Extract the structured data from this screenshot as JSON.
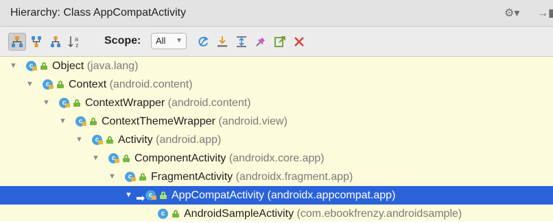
{
  "title": "Hierarchy: Class AppCompatActivity",
  "title_actions": {
    "gear": "⚙︎▾",
    "pin": "→▮"
  },
  "toolbar": {
    "scope_label": "Scope:",
    "scope_value": "All",
    "tools": [
      "class-hierarchy-icon",
      "supertypes-icon",
      "subtypes-icon",
      "sort-alphabetically-icon",
      "refresh-icon",
      "export-icon",
      "expand-all-icon",
      "pin-icon",
      "open-icon",
      "close-icon"
    ]
  },
  "tree": [
    {
      "name": "Object",
      "pkg": "(java.lang)",
      "expanded": true,
      "selected": false
    },
    {
      "name": "Context",
      "pkg": "(android.content)",
      "expanded": true,
      "selected": false
    },
    {
      "name": "ContextWrapper",
      "pkg": "(android.content)",
      "expanded": true,
      "selected": false
    },
    {
      "name": "ContextThemeWrapper",
      "pkg": "(android.view)",
      "expanded": true,
      "selected": false
    },
    {
      "name": "Activity",
      "pkg": "(android.app)",
      "expanded": true,
      "selected": false
    },
    {
      "name": "ComponentActivity",
      "pkg": "(androidx.core.app)",
      "expanded": true,
      "selected": false
    },
    {
      "name": "FragmentActivity",
      "pkg": "(androidx.fragment.app)",
      "expanded": true,
      "selected": false
    },
    {
      "name": "AppCompatActivity",
      "pkg": "(androidx.appcompat.app)",
      "expanded": true,
      "selected": true
    },
    {
      "name": "AndroidSampleActivity",
      "pkg": "(com.ebookfrenzy.androidsample)",
      "expanded": false,
      "selected": false
    }
  ],
  "colors": {
    "tree_bg": "#fcfbdb",
    "selection": "#2a63d9",
    "class_icon": "#4ba3df",
    "public_icon": "#76b640"
  }
}
